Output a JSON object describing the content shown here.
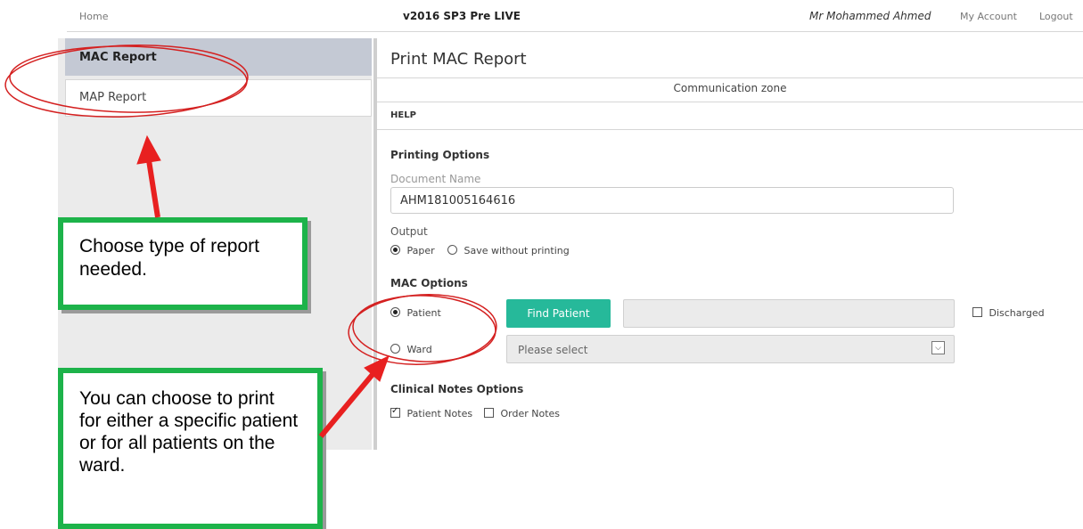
{
  "header": {
    "home_link": "Home",
    "version": "v2016 SP3 Pre LIVE",
    "user_name": "Mr Mohammed Ahmed",
    "my_account": "My Account",
    "logout": "Logout"
  },
  "sidebar": {
    "items": [
      {
        "label": "MAC Report",
        "active": true
      },
      {
        "label": "MAP Report",
        "active": false
      }
    ]
  },
  "main": {
    "title": "Print MAC Report",
    "communication_zone": "Communication zone",
    "help_label": "HELP",
    "printing_options": {
      "heading": "Printing Options",
      "doc_name_label": "Document Name",
      "doc_name_value": "AHM181005164616",
      "output_label": "Output",
      "output_options": [
        {
          "label": "Paper",
          "selected": true
        },
        {
          "label": "Save without printing",
          "selected": false
        }
      ]
    },
    "mac_options": {
      "heading": "MAC Options",
      "patient_label": "Patient",
      "patient_selected": true,
      "find_patient_button": "Find Patient",
      "patient_value": "",
      "discharged_label": "Discharged",
      "discharged_checked": false,
      "ward_label": "Ward",
      "ward_selected": false,
      "ward_placeholder": "Please select"
    },
    "clinical_notes": {
      "heading": "Clinical Notes Options",
      "options": [
        {
          "label": "Patient Notes",
          "checked": true
        },
        {
          "label": "Order Notes",
          "checked": false
        }
      ]
    }
  },
  "annotations": {
    "note1": "Choose type of report needed.",
    "note2": "You can choose to print for either a specific patient or for all patients on the ward."
  },
  "colors": {
    "accent_button": "#26b99a",
    "annotation_border": "#1db34a",
    "annotation_ellipse": "#d42020",
    "annotation_arrow": "#e82020",
    "sidebar_active_bg": "#c4c9d4"
  },
  "icons": {
    "ward_dropdown": "chevron-down-icon"
  }
}
